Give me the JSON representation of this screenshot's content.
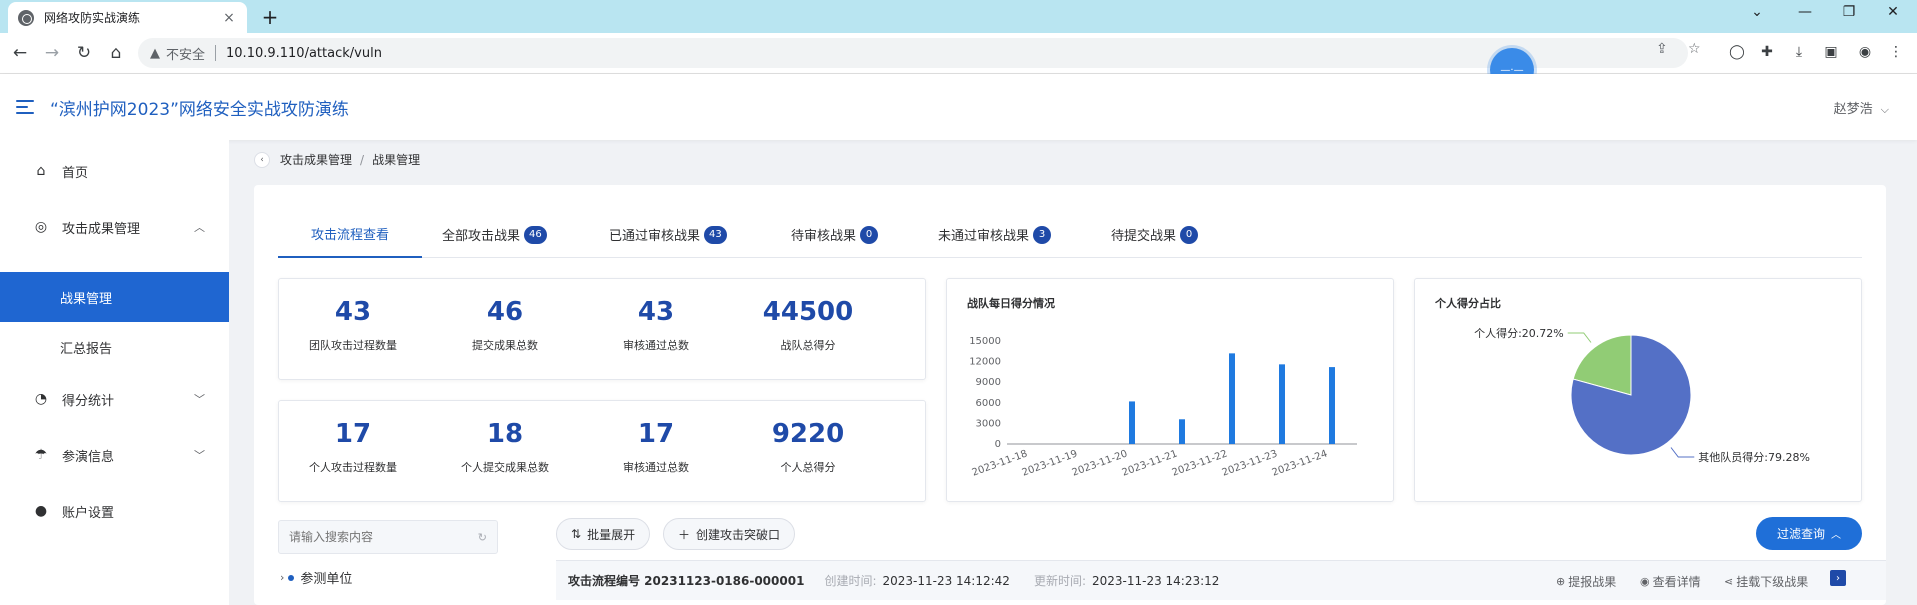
{
  "browser": {
    "tab_title": "网络攻防实战演练",
    "tab_close": "×",
    "new_tab": "+",
    "security_label": "不安全",
    "url": "10.10.9.110/attack/vuln"
  },
  "header": {
    "title": "“滨州护网2023”网络安全实战攻防演练",
    "user": "赵梦浩"
  },
  "sidebar": {
    "items": [
      {
        "label": "首页",
        "icon": "home-icon"
      },
      {
        "label": "攻击成果管理",
        "icon": "target-icon"
      },
      {
        "label": "战果管理"
      },
      {
        "label": "汇总报告"
      },
      {
        "label": "得分统计",
        "icon": "chart-icon"
      },
      {
        "label": "参演信息",
        "icon": "umbrella-icon"
      },
      {
        "label": "账户设置",
        "icon": "user-icon"
      }
    ],
    "active_color": "#1f66d1"
  },
  "breadcrumb": {
    "items": [
      "攻击成果管理",
      "战果管理"
    ],
    "separator": "/"
  },
  "tabs": [
    {
      "label": "攻击流程查看"
    },
    {
      "label": "全部攻击战果",
      "count": "46"
    },
    {
      "label": "已通过审核战果",
      "count": "43"
    },
    {
      "label": "待审核战果",
      "count": "0"
    },
    {
      "label": "未通过审核战果",
      "count": "3"
    },
    {
      "label": "待提交战果",
      "count": "0"
    }
  ],
  "team_stats": [
    {
      "value": "43",
      "label": "团队攻击过程数量"
    },
    {
      "value": "46",
      "label": "提交成果总数"
    },
    {
      "value": "43",
      "label": "审核通过总数"
    },
    {
      "value": "44500",
      "label": "战队总得分"
    }
  ],
  "personal_stats": [
    {
      "value": "17",
      "label": "个人攻击过程数量"
    },
    {
      "value": "18",
      "label": "个人提交成果总数"
    },
    {
      "value": "17",
      "label": "审核通过总数"
    },
    {
      "value": "9220",
      "label": "个人总得分"
    }
  ],
  "chart_data": [
    {
      "type": "bar",
      "title": "战队每日得分情况",
      "categories": [
        "2023-11-18",
        "2023-11-19",
        "2023-11-20",
        "2023-11-21",
        "2023-11-22",
        "2023-11-23",
        "2023-11-24"
      ],
      "values": [
        0,
        0,
        6200,
        3600,
        13200,
        11600,
        11200
      ],
      "ylim": [
        0,
        15000
      ],
      "yticks": [
        0,
        3000,
        6000,
        9000,
        12000,
        15000
      ],
      "color": "#1f7ae0"
    },
    {
      "type": "pie",
      "title": "个人得分占比",
      "slices": [
        {
          "label": "个人得分:20.72%",
          "value": 20.72,
          "color": "#91cc75"
        },
        {
          "label": "其他队员得分:79.28%",
          "value": 79.28,
          "color": "#5470c6"
        }
      ]
    }
  ],
  "toolbar": {
    "search_placeholder": "请输入搜索内容",
    "tree_node": "参测单位",
    "expand_all": "批量展开",
    "create_breakthrough": "创建攻击突破口",
    "filter_query": "过滤查询"
  },
  "record": {
    "id_label": "攻击流程编号 20231123-0186-000001",
    "created_key": "创建时间:",
    "created_val": "2023-11-23 14:12:42",
    "updated_key": "更新时间:",
    "updated_val": "2023-11-23 14:23:12",
    "actions": [
      "提报战果",
      "查看详情",
      "挂载下级战果"
    ]
  }
}
